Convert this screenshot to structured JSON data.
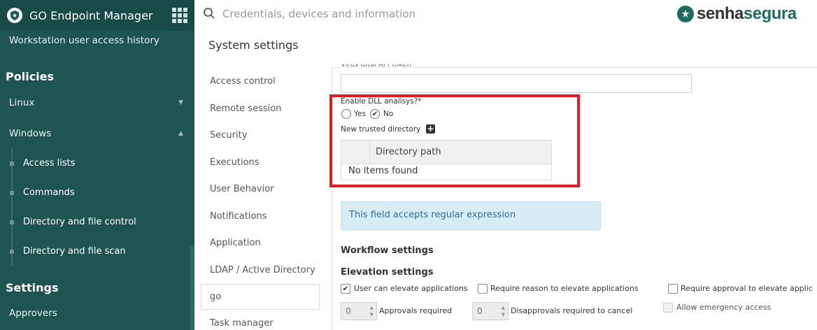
{
  "app": {
    "title": "GO Endpoint Manager",
    "logo_icon": "shield-star-icon",
    "grid_icon": "apps-grid-icon"
  },
  "search": {
    "placeholder": "Credentials, devices and information"
  },
  "brand": {
    "part1": "senha",
    "part2": "segura",
    "color": "#1f6b62"
  },
  "sidebar": {
    "top_item": "Workstation user access history",
    "policies_header": "Policies",
    "linux": "Linux",
    "windows": "Windows",
    "windows_items": [
      "Access lists",
      "Commands",
      "Directory and file control",
      "Directory and file scan"
    ],
    "settings_header": "Settings",
    "approvers": "Approvers",
    "bg_color": "#1f5551"
  },
  "page_title": "System settings",
  "settings_nav": [
    "Access control",
    "Remote session",
    "Security",
    "Executions",
    "User Behavior",
    "Notifications",
    "Application",
    "LDAP / Active Directory",
    "go",
    "Task manager"
  ],
  "settings_nav_active": "go",
  "form": {
    "cut_label": "Virus total API token",
    "dll_label": "Enable DLL analisys?*",
    "radio_yes": "Yes",
    "radio_no": "No",
    "radio_selected": "No",
    "trusted_dir_label": "New trusted directory",
    "table_header": "Directory path",
    "table_empty": "No items found",
    "info_text": "This field accepts regular expression",
    "workflow_title": "Workflow settings",
    "elevation_title": "Elevation settings",
    "chk_elevate": "User can elevate applications",
    "chk_elevate_checked": true,
    "chk_reason": "Require reason to elevate applications",
    "chk_approval": "Require approval to elevate applic",
    "approvals_value": "0",
    "approvals_label": "Approvals required",
    "disapprovals_value": "0",
    "disapprovals_label": "Disapprovals required to cancel",
    "emergency_label": "Allow emergency access",
    "highlight_color": "#e21c24"
  }
}
